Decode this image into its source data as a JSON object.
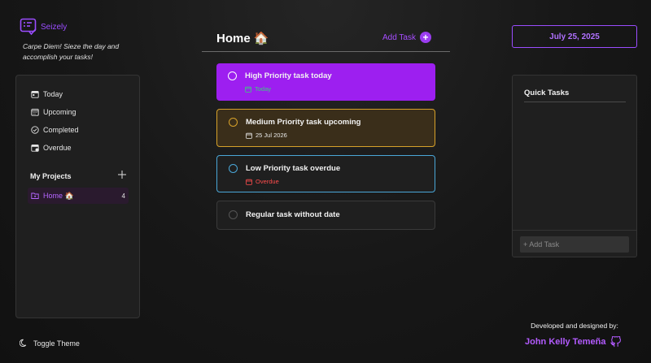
{
  "app": {
    "name": "Seizely",
    "tagline": "Carpe Diem! Sieze the day and accomplish your tasks!",
    "brand_color": "#9b4dff"
  },
  "sidebar": {
    "nav": [
      {
        "label": "Today",
        "icon": "calendar-today-icon"
      },
      {
        "label": "Upcoming",
        "icon": "calendar-week-icon"
      },
      {
        "label": "Completed",
        "icon": "check-circle-icon"
      },
      {
        "label": "Overdue",
        "icon": "calendar-alert-icon"
      }
    ],
    "projects_title": "My Projects",
    "projects": [
      {
        "label": "Home 🏠",
        "count": "4",
        "icon": "folder-icon"
      }
    ]
  },
  "footer": {
    "toggle_theme": "Toggle Theme"
  },
  "main": {
    "title": "Home 🏠",
    "add_task_label": "Add Task",
    "tasks": [
      {
        "title": "High Priority task today",
        "date": "Today",
        "priority_color": "#9d1ff0",
        "date_color": "#39d17a"
      },
      {
        "title": "Medium Priority task upcoming",
        "date": "25 Jul 2026",
        "priority_color": "#d7a22a",
        "date_color": "#e8e8e8"
      },
      {
        "title": "Low Priority task overdue",
        "date": "Overdue",
        "priority_color": "#4aa7d8",
        "date_color": "#ff4d4d"
      },
      {
        "title": "Regular task without date",
        "date": "",
        "priority_color": "#3a3a3a",
        "date_color": ""
      }
    ]
  },
  "right": {
    "date": "July 25, 2025",
    "quick_tasks_title": "Quick Tasks",
    "quick_add_placeholder": "+ Add Task"
  },
  "credits": {
    "label": "Developed and designed by:",
    "name": "John Kelly Temeña"
  }
}
